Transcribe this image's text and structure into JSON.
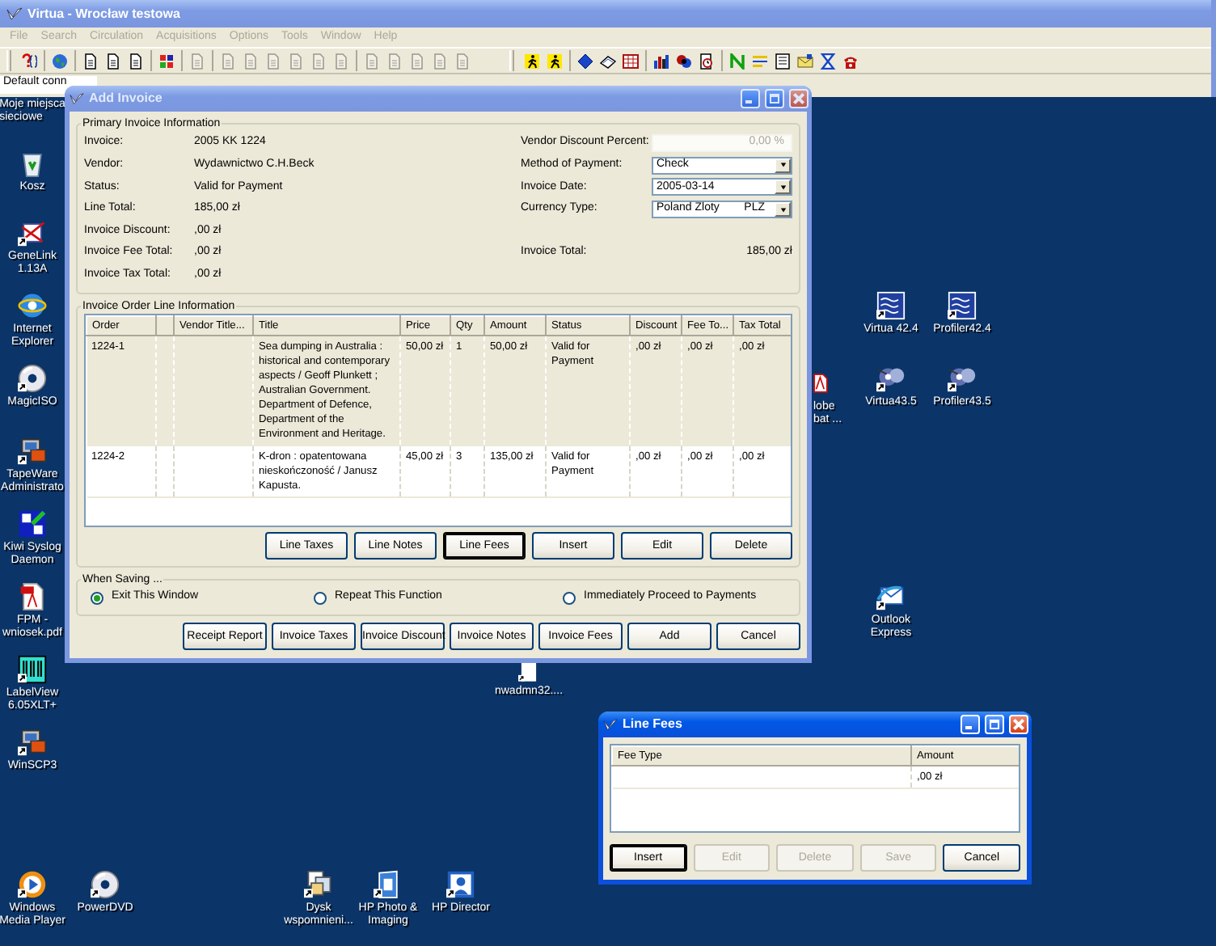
{
  "main_window": {
    "title": "Virtua - Wrocław testowa",
    "active": false,
    "menu": [
      {
        "label": "File",
        "disabled": true
      },
      {
        "label": "Search",
        "disabled": true
      },
      {
        "label": "Circulation",
        "disabled": true
      },
      {
        "label": "Acquisitions",
        "disabled": true
      },
      {
        "label": "Options",
        "disabled": true
      },
      {
        "label": "Tools",
        "disabled": true
      },
      {
        "label": "Window",
        "disabled": true
      },
      {
        "label": "Help",
        "disabled": true
      }
    ],
    "toolbar_left": [
      [
        {
          "kind": "help",
          "disabled": false
        }
      ],
      [
        {
          "kind": "globe",
          "disabled": false
        }
      ],
      [
        {
          "kind": "page",
          "disabled": false
        },
        {
          "kind": "page",
          "disabled": false
        },
        {
          "kind": "page",
          "disabled": false
        }
      ],
      [
        {
          "kind": "grid",
          "disabled": false
        }
      ],
      [
        {
          "kind": "page",
          "disabled": true
        }
      ],
      [
        {
          "kind": "page",
          "disabled": true
        },
        {
          "kind": "page",
          "disabled": true
        },
        {
          "kind": "page",
          "disabled": true
        },
        {
          "kind": "page",
          "disabled": true
        },
        {
          "kind": "page",
          "disabled": true
        },
        {
          "kind": "page",
          "disabled": true
        }
      ],
      [
        {
          "kind": "page",
          "disabled": true
        },
        {
          "kind": "page",
          "disabled": true
        },
        {
          "kind": "page",
          "disabled": true
        },
        {
          "kind": "page",
          "disabled": true
        },
        {
          "kind": "page",
          "disabled": true
        }
      ]
    ],
    "toolbar_right": [
      [
        {
          "kind": "person",
          "disabled": false
        },
        {
          "kind": "person",
          "disabled": false
        }
      ],
      [
        {
          "kind": "diamond",
          "disabled": false
        },
        {
          "kind": "book",
          "disabled": false
        },
        {
          "kind": "calendar",
          "disabled": false
        }
      ],
      [
        {
          "kind": "chart",
          "disabled": false
        },
        {
          "kind": "drum",
          "disabled": false
        },
        {
          "kind": "clock",
          "disabled": false
        }
      ],
      [
        {
          "kind": "zigzag",
          "disabled": false
        },
        {
          "kind": "lines",
          "disabled": false
        },
        {
          "kind": "list",
          "disabled": false
        },
        {
          "kind": "letter",
          "disabled": false
        },
        {
          "kind": "hourglass",
          "disabled": false
        },
        {
          "kind": "phone",
          "disabled": false
        }
      ]
    ],
    "status_text": "Default conn"
  },
  "add_invoice": {
    "title": "Add Invoice",
    "active": false,
    "primary": {
      "title": "Primary Invoice Information",
      "rows": [
        {
          "label": "Invoice:",
          "value": "2005 KK 1224",
          "right": {
            "kind": "field",
            "label": "Vendor Discount Percent:",
            "value": "0,00 %",
            "disabled": true
          }
        },
        {
          "label": "Vendor:",
          "value": "Wydawnictwo C.H.Beck",
          "right": {
            "kind": "select",
            "label": "Method of Payment:",
            "value": "Check"
          }
        },
        {
          "label": "Status:",
          "value": "Valid for Payment",
          "right": {
            "kind": "select",
            "label": "Invoice Date:",
            "value": "2005-03-14"
          }
        },
        {
          "label": "Line Total:",
          "value": "185,00 zł",
          "right": {
            "kind": "select",
            "label": "Currency Type:",
            "value": "Poland Zloty",
            "code": "PLZ"
          }
        },
        {
          "label": "Invoice Discount:",
          "value": ",00 zł"
        },
        {
          "label": "Invoice Fee Total:",
          "value": ",00 zł",
          "right": {
            "kind": "text",
            "label": "Invoice Total:",
            "value": "185,00 zł"
          }
        },
        {
          "label": "Invoice Tax Total:",
          "value": ",00 zł"
        }
      ]
    },
    "order_lines": {
      "title": "Invoice Order Line Information",
      "columns": [
        "Order",
        null,
        "Vendor Title...",
        "Title",
        "Price",
        "Qty",
        "Amount",
        "Status",
        "Discount",
        "Fee To...",
        "Tax Total"
      ],
      "rows": [
        {
          "selected": true,
          "cells": [
            "1224-1",
            null,
            null,
            "Sea dumping in Australia : historical and contemporary aspects / Geoff Plunkett ; Australian Government. Department of Defence, Department of the Environment and Heritage.",
            "50,00 zł",
            "1",
            "50,00 zł",
            "Valid for Payment",
            ",00 zł",
            ",00 zł",
            ",00 zł"
          ]
        },
        {
          "selected": false,
          "cells": [
            "1224-2",
            null,
            null,
            "K-dron : opatentowana nieskończoność / Janusz Kapusta.",
            "45,00 zł",
            "3",
            "135,00 zł",
            "Valid for Payment",
            ",00 zł",
            ",00 zł",
            ",00 zł"
          ]
        }
      ],
      "buttons": [
        {
          "label": "Line Taxes",
          "focused": false
        },
        {
          "label": "Line Notes",
          "focused": false
        },
        {
          "label": "Line Fees",
          "focused": true
        },
        {
          "label": "Insert",
          "focused": false
        },
        {
          "label": "Edit",
          "focused": false
        },
        {
          "label": "Delete",
          "focused": false
        }
      ]
    },
    "when_saving": {
      "title": "When Saving ...",
      "options": [
        {
          "label": "Exit This Window",
          "selected": true
        },
        {
          "label": "Repeat This Function",
          "selected": false
        },
        {
          "label": "Immediately Proceed to Payments",
          "selected": false
        }
      ]
    },
    "buttons": [
      {
        "label": "Receipt Report"
      },
      {
        "label": "Invoice Taxes"
      },
      {
        "label": "Invoice Discount"
      },
      {
        "label": "Invoice Notes"
      },
      {
        "label": "Invoice Fees"
      },
      {
        "label": "Add"
      },
      {
        "label": "Cancel"
      }
    ]
  },
  "line_fees": {
    "title": "Line Fees",
    "active": true,
    "columns": [
      "Fee Type",
      "Amount"
    ],
    "rows": [
      {
        "amount": ",00 zł"
      }
    ],
    "buttons": [
      {
        "label": "Insert",
        "disabled": false,
        "focused": true
      },
      {
        "label": "Edit",
        "disabled": true,
        "focused": false
      },
      {
        "label": "Delete",
        "disabled": true,
        "focused": false
      },
      {
        "label": "Save",
        "disabled": true,
        "focused": false
      },
      {
        "label": "Cancel",
        "disabled": false,
        "focused": false
      }
    ]
  },
  "desktop_icons": [
    {
      "kind": "label-only",
      "label_lines": [
        "Moje miejsca",
        "sieciowe"
      ]
    },
    {
      "kind": "bin",
      "label_lines": [
        "Kosz"
      ]
    },
    {
      "kind": "crossed",
      "label_lines": [
        "GeneLink",
        "1.13A"
      ]
    },
    {
      "kind": "globe",
      "label_lines": [
        "Internet",
        "Explorer"
      ]
    },
    {
      "kind": "disc",
      "label_lines": [
        "MagicISO"
      ]
    },
    {
      "kind": "computer",
      "label_lines": [
        "TapeWare",
        "Administrato"
      ]
    },
    {
      "kind": "blocks",
      "label_lines": [
        "Kiwi Syslog",
        "Daemon"
      ]
    },
    {
      "kind": "pdf",
      "label_lines": [
        "FPM -",
        "wniosek.pdf"
      ]
    },
    {
      "kind": "barcode",
      "label_lines": [
        "LabelView",
        "6.05XLT+"
      ]
    },
    {
      "kind": "computer",
      "label_lines": [
        "WinSCP3"
      ]
    },
    {
      "kind": "media",
      "label_lines": [
        "Windows",
        "Media Player"
      ]
    },
    {
      "kind": "disc",
      "label_lines": [
        "PowerDVD"
      ]
    },
    {
      "kind": "photos",
      "label_lines": [
        "Dysk",
        "wspomnieni..."
      ]
    },
    {
      "kind": "book",
      "label_lines": [
        "HP Photo &",
        "Imaging"
      ]
    },
    {
      "kind": "frame",
      "label_lines": [
        "HP Director"
      ]
    },
    {
      "kind": "waves",
      "label_lines": [
        "Virtua 42.4"
      ]
    },
    {
      "kind": "waves",
      "label_lines": [
        "Profiler42.4"
      ]
    },
    {
      "kind": "gears",
      "label_lines": [
        "Virtua43.5"
      ]
    },
    {
      "kind": "gears",
      "label_lines": [
        "Profiler43.5"
      ]
    },
    {
      "kind": "pdf-cut",
      "label_lines": [
        "lobe",
        "bat ..."
      ]
    },
    {
      "kind": "mail",
      "label_lines": [
        "Outlook",
        "Express"
      ]
    },
    {
      "kind": "page",
      "label_lines": [
        "nwadmn32...."
      ]
    }
  ]
}
